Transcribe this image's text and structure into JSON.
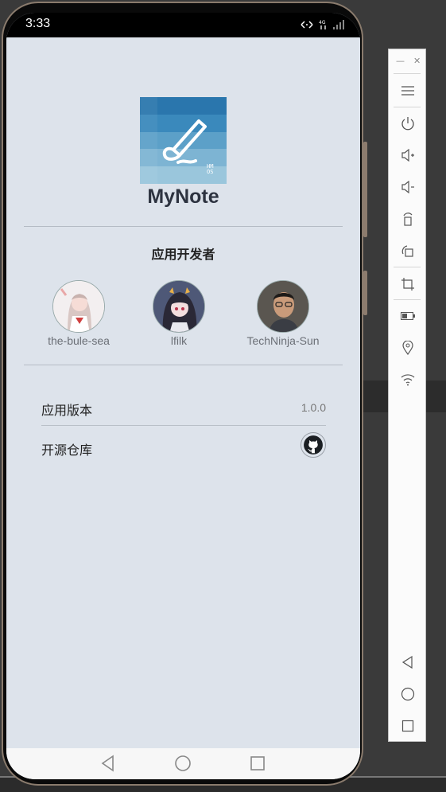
{
  "status_bar": {
    "time": "3:33",
    "icons": [
      "signal-icon",
      "network-speed-icon",
      "cellular-icon"
    ]
  },
  "app": {
    "name": "MyNote",
    "logo_text": "HMOS",
    "developers_title": "应用开发者",
    "developers": [
      {
        "name": "the-bule-sea",
        "avatar": "anime-girl-avatar"
      },
      {
        "name": "lfilk",
        "avatar": "anime-girl-dark-avatar"
      },
      {
        "name": "TechNinja-Sun",
        "avatar": "person-photo-avatar"
      }
    ],
    "info_rows": [
      {
        "label": "应用版本",
        "value": "1.0.0"
      },
      {
        "label": "开源仓库",
        "icon": "github-icon"
      }
    ]
  },
  "nav_bar": {
    "buttons": [
      "back-icon",
      "home-icon",
      "recents-icon"
    ]
  },
  "emulator_toolbar": {
    "items": [
      "minimize-icon",
      "close-icon",
      "menu-icon",
      "power-icon",
      "volume-up-icon",
      "volume-down-icon",
      "rotate-icon",
      "rotate-alt-icon",
      "crop-icon",
      "battery-icon",
      "location-icon",
      "wifi-icon",
      "back-icon",
      "home-icon",
      "recents-icon"
    ]
  },
  "colors": {
    "screen_bg": "#dde3eb",
    "text_dark": "#2d3340",
    "logo_blue": "#2a7fb6"
  }
}
